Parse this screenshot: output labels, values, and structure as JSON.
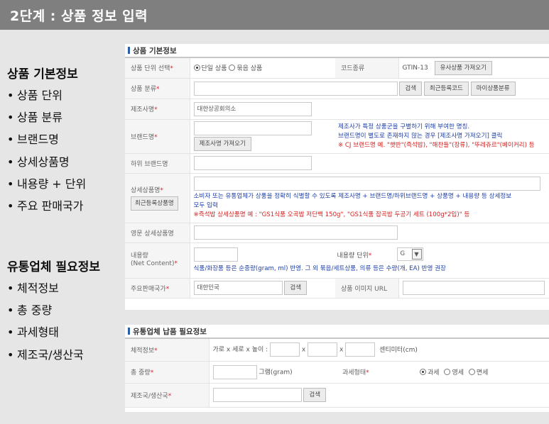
{
  "header": {
    "title": "2단계 :  상품 정보 입력"
  },
  "left_basic": {
    "heading": "상품 기본정보",
    "items": [
      "상품 단위",
      "상품 분류",
      "브랜드명",
      "상세상품명",
      "내용량 + 단위",
      "주요 판매국가"
    ]
  },
  "left_dist": {
    "heading": "유통업체 필요정보",
    "items": [
      "체적정보",
      "총 중량",
      "과세형태",
      "제조국/생산국"
    ]
  },
  "bullet": "•",
  "required_mark": "*",
  "basic_panel": {
    "title": "상품 기본정보",
    "unit_label": "상품 단위 선택",
    "unit_option_single": "단일 상품",
    "unit_option_bundle": "묶음 상품",
    "code_label": "코드종류",
    "code_value": "GTIN-13",
    "similar_button": "유사상품 가져오기",
    "category_label": "상품 분류",
    "search_button": "검색",
    "recent_code_button": "최근등록코드",
    "my_category_button": "마이상품분류",
    "maker_label": "제조사명",
    "maker_value": "대한상공회의소",
    "brand_label": "브랜드명",
    "brand_button": "제조사명 가져오기",
    "brand_help1": "제조사가 특정 상품군을 구별하기 위해 부여한 명칭.",
    "brand_help2": "브랜드명이 별도로 존재하지 않는 경우 [제조사명 가져오기] 클릭",
    "brand_example": "※ CJ 브랜드명 예. \"햇반\"(즉석밥), \"해찬들\"(장류), \"뚜레쥬르\"(베이커리) 등",
    "sub_brand_label": "하위 브랜드명",
    "detail_label": "상세상품명",
    "detail_button": "최근등록상품명",
    "detail_help1": "소비자 또는 유통업체가 상품을 정확히 식별할 수 있도록 제조사명 + 브랜드명/하위브랜드명 + 상품명 + 내용량 등 상세정보",
    "detail_help2": "모두 입력",
    "detail_example": "※즉석밥 상세상품명 예 : \"GS1식품 오곡밥 저단백 150g\", \"GS1식품 잡곡밥 두공기 세트 (100g*2입)\" 등",
    "eng_label": "영문 상세상품명",
    "content_label": "내용량",
    "content_sub": "(Net Content)",
    "content_unit_label": "내용량 단위",
    "content_unit_value": "G",
    "content_help": "식품/화장품 등은 순중량(gram, ml) 반영. 그 외 묶음/세트상품, 의류 등은 수량(개, EA) 반영 권장",
    "country_label": "주요판매국가",
    "country_value": "대한민국",
    "image_url_label": "상품 이미지 URL"
  },
  "dist_panel": {
    "title": "유통업체 납품 필요정보",
    "volume_label": "체적정보",
    "volume_prefix": "가로 x 세로 x 높이 :",
    "times": "x",
    "volume_unit": "센티미터(cm)",
    "weight_label": "총 중량",
    "weight_unit": "그램(gram)",
    "tax_label": "과세형태",
    "tax_options": [
      "과세",
      "영세",
      "면세"
    ],
    "origin_label": "제조국/생산국",
    "search_button": "검색"
  }
}
